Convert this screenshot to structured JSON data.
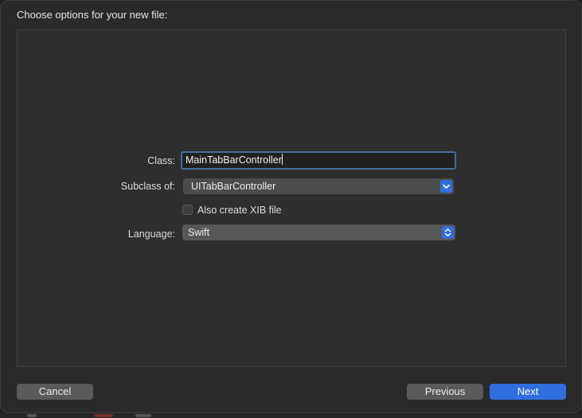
{
  "dialog": {
    "title": "Choose options for your new file:"
  },
  "form": {
    "class_label": "Class:",
    "class_value": "MainTabBarController",
    "subclass_label": "Subclass of:",
    "subclass_value": "UITabBarController",
    "xib_label": "Also create XIB file",
    "xib_checked": false,
    "language_label": "Language:",
    "language_value": "Swift"
  },
  "buttons": {
    "cancel": "Cancel",
    "previous": "Previous",
    "next": "Next"
  },
  "icons": {
    "subclass_popup": "chevron-down-icon",
    "language_popup": "up-down-chevron-icon"
  },
  "colors": {
    "accent": "#2f6fe0",
    "focus_ring": "#466d96",
    "background": "#2a2a2a"
  }
}
